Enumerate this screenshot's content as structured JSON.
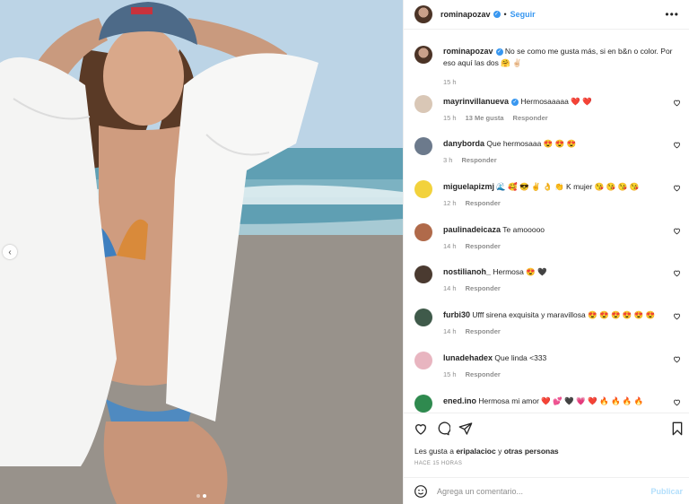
{
  "post": {
    "author": "rominapozav",
    "follow_label": "Seguir",
    "more_icon": "more-horizontal-icon",
    "dots_count": 2,
    "active_dot": 1
  },
  "caption": {
    "username": "rominapozav",
    "text": "No se como me gusta más, si en b&n o color. Por eso aquí las dos 🤗 ✌🏻",
    "time": "15 h"
  },
  "comments": [
    {
      "username": "mayrinvillanueva",
      "verified": true,
      "text": "Hermosaaaaa ❤️ ❤️",
      "time": "15 h",
      "likes": "13 Me gusta",
      "reply": "Responder",
      "avatar_color": "#d9c7b6"
    },
    {
      "username": "danyborda",
      "verified": false,
      "text": "Que hermosaaa 😍 😍 😍",
      "time": "3 h",
      "likes": "",
      "reply": "Responder",
      "avatar_color": "#6c7a8c"
    },
    {
      "username": "miguelapizmj",
      "verified": false,
      "text": "🌊 🥰 😎 ✌️ 👌 👏 K mujer 😘 😘 😘 😘",
      "time": "12 h",
      "likes": "",
      "reply": "Responder",
      "avatar_color": "#f2d23c"
    },
    {
      "username": "paulinadeicaza",
      "verified": false,
      "text": "Te amooooo",
      "time": "14 h",
      "likes": "",
      "reply": "Responder",
      "avatar_color": "#b06a4a"
    },
    {
      "username": "nostilianoh_",
      "verified": false,
      "text": "Hermosa 😍 🖤",
      "time": "14 h",
      "likes": "",
      "reply": "Responder",
      "avatar_color": "#4a3a30"
    },
    {
      "username": "furbi30",
      "verified": false,
      "text": "Ufff sirena exquisita y maravillosa 😍 😍 😍 😍 😍 😍",
      "time": "14 h",
      "likes": "",
      "reply": "Responder",
      "avatar_color": "#3f5a4a"
    },
    {
      "username": "lunadehadex",
      "verified": false,
      "text": "Que linda <333",
      "time": "15 h",
      "likes": "",
      "reply": "Responder",
      "avatar_color": "#e8b5c0"
    },
    {
      "username": "ened.ino",
      "verified": false,
      "text": "Hermosa mi amor ❤️ 💕 🖤 💗 ❤️ 🔥 🔥 🔥 🔥",
      "time": "",
      "likes": "",
      "reply": "",
      "avatar_color": "#2f8a4f"
    }
  ],
  "actions": {
    "like_icon": "heart-icon",
    "comment_icon": "comment-icon",
    "share_icon": "paper-plane-icon",
    "save_icon": "bookmark-icon",
    "likes_prefix": "Les gusta a ",
    "likes_user": "eripalacioc",
    "likes_suffix": " y ",
    "likes_others": "otras personas",
    "posted_ago": "Hace 15 horas"
  },
  "add_comment": {
    "placeholder": "Agrega un comentario...",
    "publish_label": "Publicar",
    "emoji_icon": "smiley-icon"
  }
}
